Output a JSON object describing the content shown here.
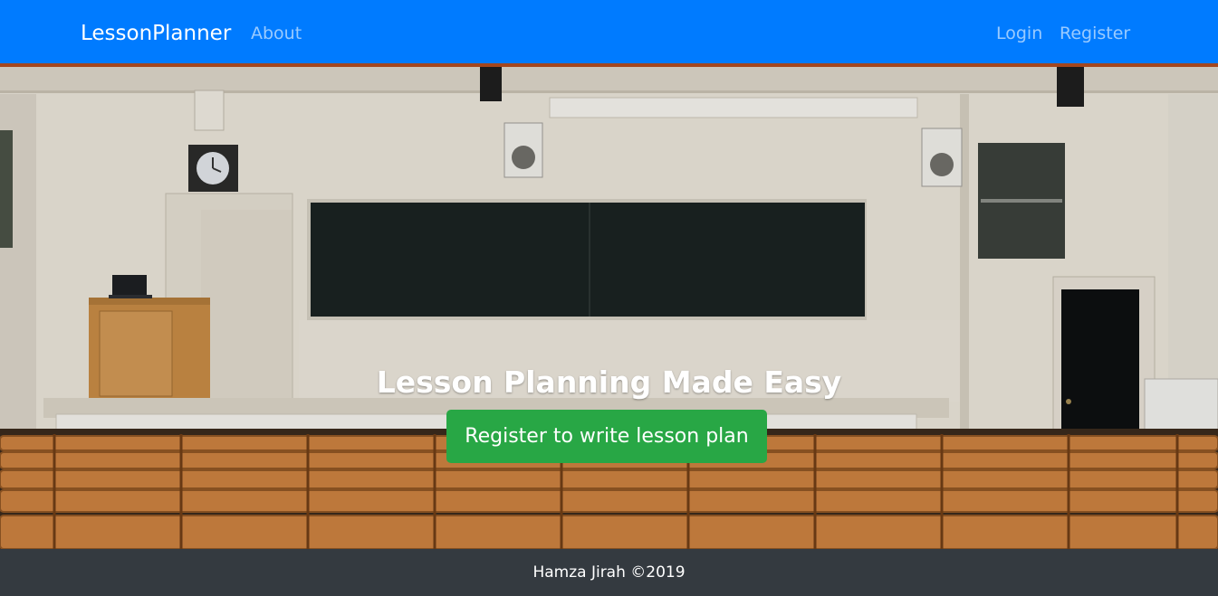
{
  "navbar": {
    "brand": "LessonPlanner",
    "links": [
      {
        "label": "About"
      },
      {
        "label": "Login"
      },
      {
        "label": "Register"
      }
    ],
    "background": "#007bff"
  },
  "hero": {
    "title": "Lesson Planning Made Easy",
    "cta_label": "Register to write lesson plan",
    "cta_color": "#28a745",
    "background_image": "lecture-hall-photo"
  },
  "footer": {
    "text": "Hamza Jirah ©2019",
    "background": "#343a40"
  }
}
